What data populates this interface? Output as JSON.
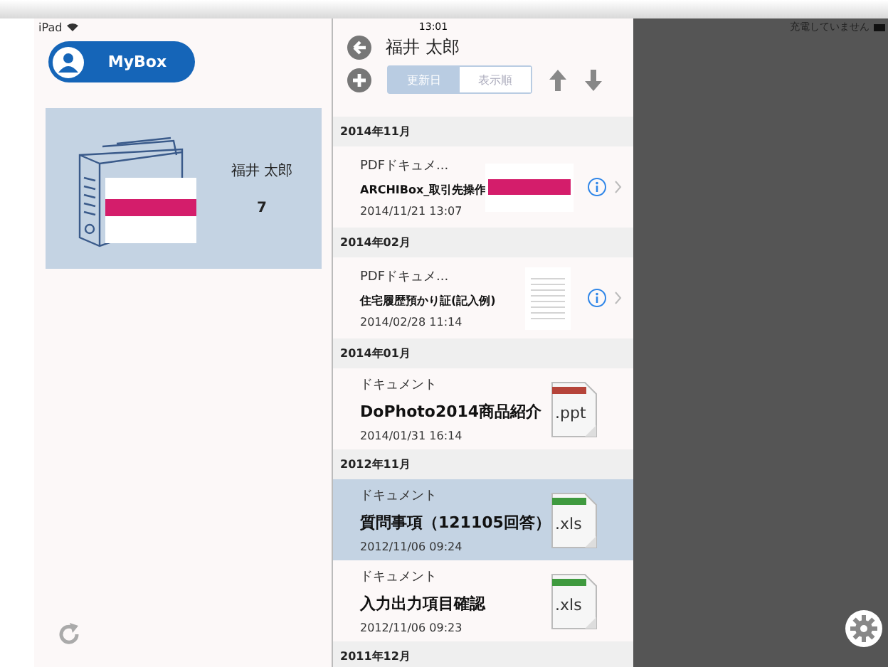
{
  "status_bar": {
    "device": "iPad",
    "time": "13:01",
    "battery_text": "充電していません"
  },
  "sidebar": {
    "mybox_button": "MyBox",
    "box_card": {
      "owner": "福井 太郎",
      "count": "7"
    }
  },
  "list_header": {
    "title": "福井 太郎",
    "sort_tabs": [
      {
        "label": "更新日",
        "selected": true
      },
      {
        "label": "表示順",
        "selected": false
      }
    ]
  },
  "sections": [
    {
      "title": "2014年11月",
      "items": [
        {
          "kind": "pdf",
          "type_label": "PDFドキュメ...",
          "title": "ARCHIBox_取引先操作",
          "date": "2014/11/21 13:07",
          "selected": false,
          "thumbnail": {
            "kind": "cover"
          }
        }
      ]
    },
    {
      "title": "2014年02月",
      "items": [
        {
          "kind": "pdf",
          "type_label": "PDFドキュメ...",
          "title": "住宅履歴預かり証(記入例)",
          "date": "2014/02/28 11:14",
          "selected": false,
          "thumbnail": {
            "kind": "form"
          }
        }
      ]
    },
    {
      "title": "2014年01月",
      "items": [
        {
          "kind": "file",
          "type_label": "ドキュメント",
          "title": "DoPhoto2014商品紹介",
          "date": "2014/01/31 16:14",
          "selected": false,
          "ext": ".ppt",
          "color": "#b5443a"
        }
      ]
    },
    {
      "title": "2012年11月",
      "items": [
        {
          "kind": "file",
          "type_label": "ドキュメント",
          "title": "質問事項（121105回答）",
          "date": "2012/11/06 09:24",
          "selected": true,
          "ext": ".xls",
          "color": "#3f9a3f"
        },
        {
          "kind": "file",
          "type_label": "ドキュメント",
          "title": "入力出力項目確認",
          "date": "2012/11/06 09:23",
          "selected": false,
          "ext": ".xls",
          "color": "#3f9a3f"
        }
      ]
    },
    {
      "title": "2011年12月"
    }
  ]
}
